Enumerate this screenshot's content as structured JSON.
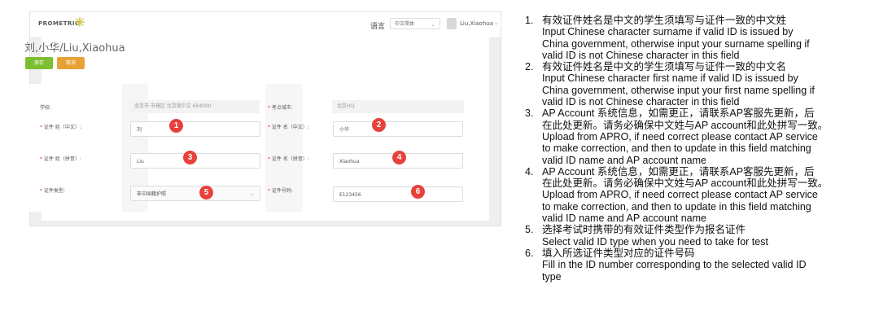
{
  "app": {
    "logo_text": "PROMETRIC",
    "language_label": "语言",
    "language_value": "中文简体",
    "user_name": "Liu,Xiaohua"
  },
  "page": {
    "title": "刘,小华/Liu,Xiaohua",
    "save_label": "保存",
    "cancel_label": "取消"
  },
  "form": {
    "school_label": "学校:",
    "school_value": "北京市 市辖区 北京营尔文 694000",
    "city_label": "考点城市:",
    "city_value": "北京HQ",
    "surname_cn_label": "证件 姓（中文）:",
    "surname_cn_value": "刘",
    "firstname_cn_label": "证件 名（中文）:",
    "firstname_cn_value": "小华",
    "surname_py_label": "证件 姓（拼音）:",
    "surname_py_value": "Liu",
    "firstname_py_label": "证件 名（拼音）:",
    "firstname_py_value": "Xiaohua",
    "idtype_label": "证件类型:",
    "idtype_value": "非中国籍护照",
    "idnum_label": "证件号码:",
    "idnum_value": "E123456",
    "required_mark": "*"
  },
  "markers": [
    "1",
    "2",
    "3",
    "4",
    "5",
    "6"
  ],
  "notes": [
    {
      "num": "1.",
      "cn": "有效证件姓名是中文的学生须填写与证件一致的中文姓",
      "en": [
        "Input Chinese character surname if valid ID is issued by",
        "China government, otherwise input your surname spelling if",
        "valid ID is not Chinese character in this field"
      ]
    },
    {
      "num": "2.",
      "cn": "有效证件姓名是中文的学生须填写与证件一致的中文名",
      "en": [
        "Input Chinese character first name if valid ID is issued by",
        "China government, otherwise input your first name spelling if",
        "valid ID is not Chinese character in this field"
      ]
    },
    {
      "num": "3.",
      "cn": "AP Account 系统信息，如需更正，请联系AP客服先更新，后",
      "cn2": "在此处更新。请务必确保中文姓与AP account和此处拼写一致。",
      "en": [
        "Upload from APRO, if need correct please contact AP service",
        "to make correction, and then to update in this field matching",
        "valid ID name and AP account name"
      ]
    },
    {
      "num": "4.",
      "cn": "AP Account 系统信息，如需更正，请联系AP客服先更新，后",
      "cn2": "在此处更新。请务必确保中文姓与AP account和此处拼写一致。",
      "en": [
        "Upload from APRO, if need correct please contact AP service",
        "to make correction, and then to update in this field matching",
        "valid ID name and AP account name"
      ]
    },
    {
      "num": "5.",
      "cn": "选择考试时携带的有效证件类型作为报名证件",
      "en": [
        "Select valid ID type when you need to take for test"
      ]
    },
    {
      "num": "6.",
      "cn": "填入所选证件类型对应的证件号码",
      "en": [
        "Fill in the ID number corresponding to the selected valid ID",
        "type"
      ]
    }
  ]
}
